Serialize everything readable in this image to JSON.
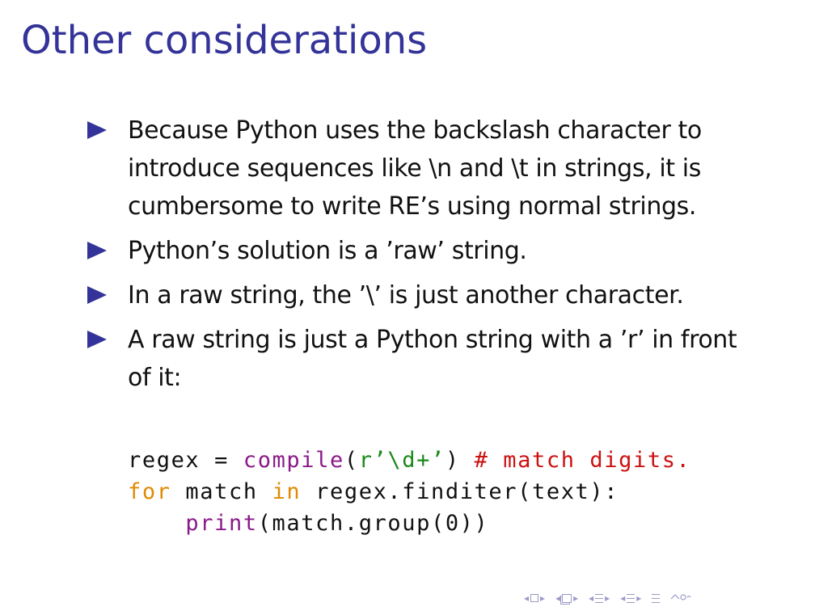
{
  "slide": {
    "title": "Other considerations",
    "bullets": [
      "Because Python uses the backslash character to introduce sequences like \\n and \\t in strings, it is cumbersome to write RE’s using normal strings.",
      "Python’s solution is a ’raw’ string.",
      "In a raw string, the ’\\’ is just another character.",
      "A raw string is just a Python string with a ’r’ in front of it:"
    ],
    "code": {
      "line1": {
        "var": "regex",
        "op": " = ",
        "fn": "compile",
        "open": "(",
        "str": "r’\\d+’",
        "close": ")",
        "comment": " # match digits."
      },
      "line2": {
        "kw_for": "for",
        "mid1": " match ",
        "kw_in": "in",
        "rest": " regex.finditer(text):"
      },
      "line3": {
        "indent": "    ",
        "fn": "print",
        "rest": "(match.group(0))"
      }
    },
    "colors": {
      "title": "#333399",
      "bullet_marker": "#333399",
      "code_function": "#8b1a89",
      "code_string": "#1a8a1a",
      "code_comment": "#cc1111",
      "code_keyword": "#e08a00",
      "nav_icons": "#9a9ac8"
    }
  },
  "navigation": {
    "icons": [
      "nav-slide-prev-icon",
      "nav-slide-icon",
      "nav-slide-next-icon",
      "nav-frame-prev-icon",
      "nav-frame-icon",
      "nav-frame-next-icon",
      "nav-subsection-prev-icon",
      "nav-subsection-icon",
      "nav-subsection-next-icon",
      "nav-section-prev-icon",
      "nav-section-icon",
      "nav-section-next-icon",
      "nav-appendix-icon",
      "nav-search-icon"
    ]
  }
}
